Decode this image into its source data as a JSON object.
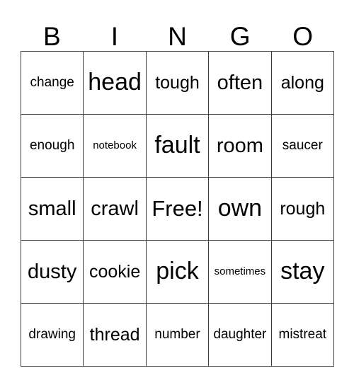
{
  "card": {
    "title_letters": [
      "B",
      "I",
      "N",
      "G",
      "O"
    ],
    "rows": [
      [
        {
          "text": "change",
          "size": "fs-sm"
        },
        {
          "text": "head",
          "size": "fs-xl"
        },
        {
          "text": "tough",
          "size": "fs-md"
        },
        {
          "text": "often",
          "size": "fs-ml"
        },
        {
          "text": "along",
          "size": "fs-md"
        }
      ],
      [
        {
          "text": "enough",
          "size": "fs-sm"
        },
        {
          "text": "notebook",
          "size": "fs-xs"
        },
        {
          "text": "fault",
          "size": "fs-xl"
        },
        {
          "text": "room",
          "size": "fs-ml"
        },
        {
          "text": "saucer",
          "size": "fs-sm"
        }
      ],
      [
        {
          "text": "small",
          "size": "fs-ml"
        },
        {
          "text": "crawl",
          "size": "fs-ml"
        },
        {
          "text": "Free!",
          "size": "fs-lg"
        },
        {
          "text": "own",
          "size": "fs-xl"
        },
        {
          "text": "rough",
          "size": "fs-md"
        }
      ],
      [
        {
          "text": "dusty",
          "size": "fs-ml"
        },
        {
          "text": "cookie",
          "size": "fs-md"
        },
        {
          "text": "pick",
          "size": "fs-xl"
        },
        {
          "text": "sometimes",
          "size": "fs-xs"
        },
        {
          "text": "stay",
          "size": "fs-xl"
        }
      ],
      [
        {
          "text": "drawing",
          "size": "fs-sm"
        },
        {
          "text": "thread",
          "size": "fs-md"
        },
        {
          "text": "number",
          "size": "fs-sm"
        },
        {
          "text": "daughter",
          "size": "fs-sm"
        },
        {
          "text": "mistreat",
          "size": "fs-sm"
        }
      ]
    ],
    "free_space": {
      "row": 2,
      "col": 2,
      "label": "Free!"
    },
    "colors": {
      "background": "#ffffff",
      "text": "#000000",
      "grid_line": "#3a3a3a"
    }
  }
}
